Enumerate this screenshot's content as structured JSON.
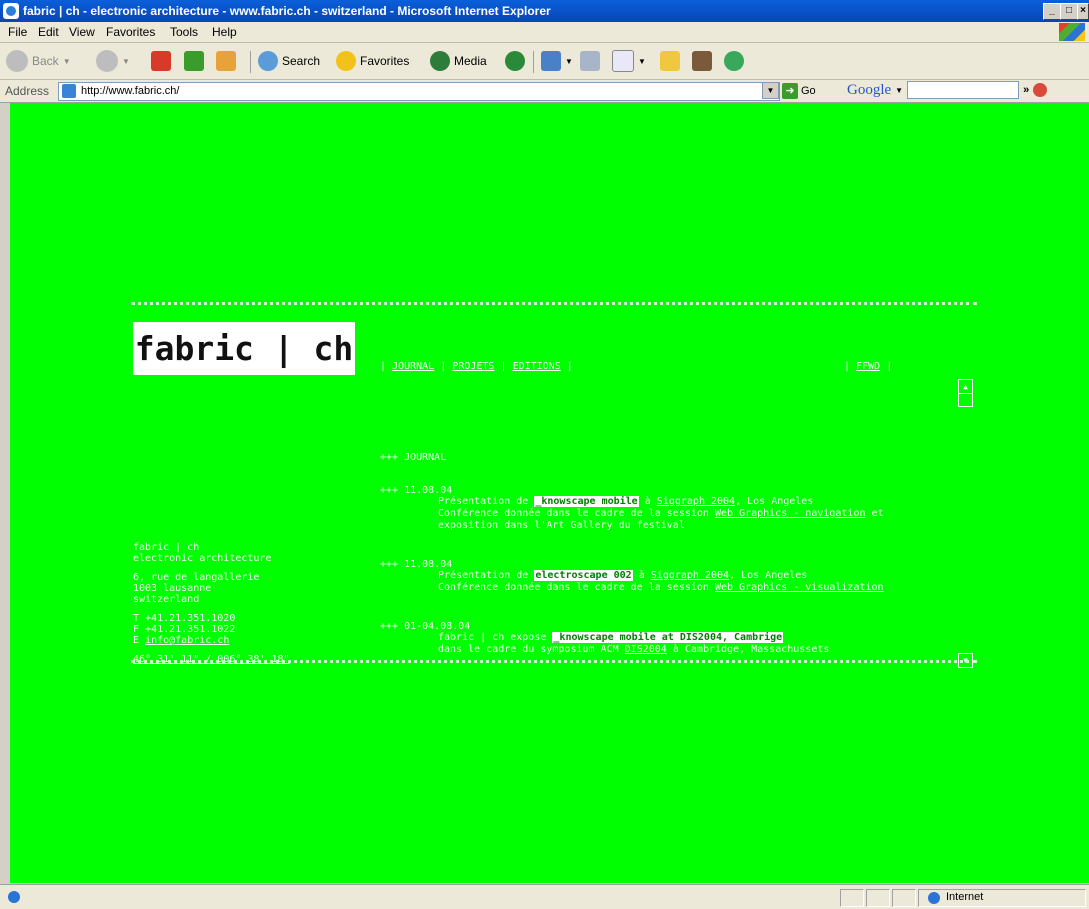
{
  "window": {
    "title": "fabric | ch - electronic architecture - www.fabric.ch - switzerland - Microsoft Internet Explorer",
    "controls": [
      "_",
      "□",
      "×"
    ]
  },
  "menubar": [
    "File",
    "Edit",
    "View",
    "Favorites",
    "Tools",
    "Help"
  ],
  "toolbar": {
    "back": "Back",
    "search": "Search",
    "favorites": "Favorites",
    "media": "Media"
  },
  "addressbar": {
    "label": "Address",
    "url": "http://www.fabric.ch/",
    "go": "Go",
    "google": "Google"
  },
  "page": {
    "logo": "fabric | ch",
    "nav": {
      "sep": "|",
      "journal": "JOURNAL",
      "projets": "PROJETS",
      "editions": "EDITIONS",
      "ffwd": "FFWD"
    },
    "section_title": "+++ JOURNAL",
    "entries": [
      {
        "date": "+++ 11.08.04",
        "l1_pre": "Présentation de",
        "l1_hl": "_knowscape mobile",
        "l1_mid": "à",
        "l1_link": "Siggraph 2004",
        "l1_post": ", Los Angeles",
        "l2_pre": "Conférence donnée dans le cadre de la session",
        "l2_link": "Web Graphics - navigation",
        "l2_post": "et",
        "l3": "exposition dans l'Art Gallery du festival"
      },
      {
        "date": "+++ 11.08.04",
        "l1_pre": "Présentation de",
        "l1_hl": "electroscape 002",
        "l1_mid": "à",
        "l1_link": "Siggraph 2004",
        "l1_post": ", Los Angeles",
        "l2_pre": "Conférence donnée dans le cadre de la session",
        "l2_link": "Web Graphics - visualization"
      },
      {
        "date": "+++ 01-04.08.04",
        "l1_pre": "fabric | ch expose",
        "l1_hl": "_knowscape mobile at DIS2004, Cambrige",
        "l2_pre": "dans le cadre du symposium ACM",
        "l2_link": "DIS2004",
        "l2_post": "à Cambridge, Massachussets"
      }
    ],
    "contact": {
      "name": "fabric | ch",
      "desc": "electronic architecture",
      "addr1": "6, rue de langallerie",
      "addr2": "1003 lausanne",
      "addr3": "switzerland",
      "tel": "T +41.21.351.1020",
      "fax": "F +41.21.351.1022",
      "email_prefix": "E",
      "email": "info@fabric.ch",
      "coords": "46° 31' 11\" / 006° 38' 18\""
    }
  },
  "statusbar": {
    "zone": "Internet"
  }
}
